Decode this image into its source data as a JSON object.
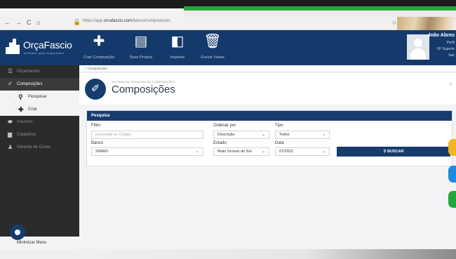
{
  "browser": {
    "nav_icons": [
      "←",
      "→",
      "C",
      "⌂"
    ],
    "url_prefix": "https://app.",
    "url_domain": "orcafascio.com",
    "url_path": "/banco/composicoes"
  },
  "brand": {
    "name": "OrçaFascio",
    "tagline": "software para engenharia"
  },
  "toolbar": [
    {
      "label": "Criar Composição",
      "icon": "plus-icon"
    },
    {
      "label": "Base Própria",
      "icon": "document-icon"
    },
    {
      "label": "Importar",
      "icon": "import-icon"
    },
    {
      "label": "Excluir Várias",
      "icon": "trash-icon"
    }
  ],
  "user": {
    "name": "João Abreu",
    "links": [
      "Perfil",
      "XP Suporte",
      "Sair"
    ]
  },
  "sidebar": {
    "items": [
      {
        "label": "Orçamentos"
      },
      {
        "label": "Composições"
      },
      {
        "label": "Pesquisar"
      },
      {
        "label": "Criar"
      },
      {
        "label": "Insumos"
      },
      {
        "label": "Cadastros"
      },
      {
        "label": "Gerente de Conta"
      }
    ],
    "minimize": "Minimizar Menu"
  },
  "breadcrumb": "Composições",
  "page": {
    "subtitle": "SISTEMA DE PESQUISA DE COMPOSIÇÕES",
    "title": "Composições"
  },
  "search": {
    "panel_title": "Pesquisa",
    "filtro_label": "Filtro",
    "filtro_placeholder": "Descrição ou Código",
    "ordenar_label": "Ordenar por",
    "ordenar_value": "Descrição",
    "tipo_label": "Tipo",
    "tipo_value": "Todos",
    "banco_label": "Banco",
    "banco_value": "SINAPI",
    "estado_label": "Estado",
    "estado_value": "Mato Grosso do Sul",
    "data_label": "Data",
    "data_value": "07/2022",
    "button": "BUSCAR"
  },
  "colors": {
    "brand": "#143a6b",
    "accent_green": "#27a837",
    "tab_yellow": "#f2b51c",
    "tab_blue": "#1d8be0",
    "tab_green": "#1fa83a"
  }
}
